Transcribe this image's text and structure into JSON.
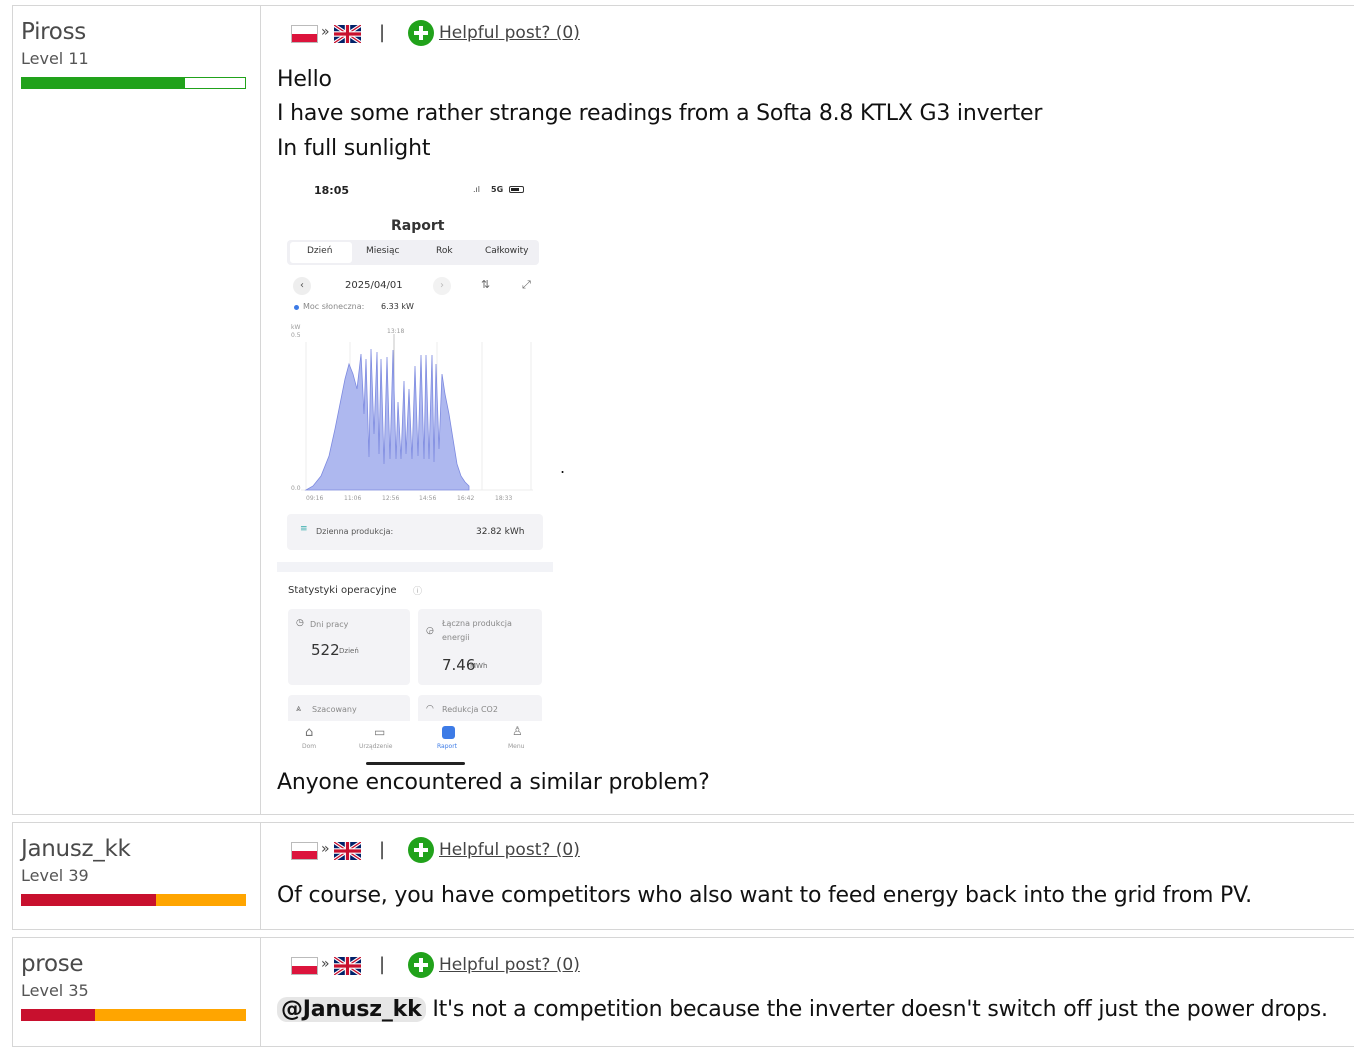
{
  "helpful_label": "Helpful post? (0)",
  "posts": [
    {
      "username": "Piross",
      "level": "Level 11",
      "level_progress": 0.73,
      "lines": [
        "Hello",
        "I have some rather strange readings from a Softa 8.8 KTLX G3 inverter",
        "In full sunlight"
      ],
      "after_image": "Anyone encountered a similar problem?",
      "trailing_mark": "."
    },
    {
      "username": "Janusz_kk",
      "level": "Level 39",
      "level_progress": 0.6,
      "text": "Of course, you have competitors who also want to feed energy back into the grid from PV."
    },
    {
      "username": "prose",
      "level": "Level 35",
      "level_progress": 0.33,
      "mention": "@Janusz_kk",
      "text": " It's not a competition because the inverter doesn't switch off just the power drops."
    }
  ],
  "screenshot": {
    "time": "18:05",
    "signal": "5G",
    "title": "Raport",
    "tabs": [
      "Dzień",
      "Miesiąc",
      "Rok",
      "Całkowity"
    ],
    "date": "2025/04/01",
    "legend_label": "Moc słoneczna:",
    "legend_value": "6.33 kW",
    "unit_label": "kW",
    "y_top": "0.5",
    "y_bottom": "0.0",
    "cursor_time": "13:18",
    "x_ticks": [
      "09:16",
      "11:06",
      "12:56",
      "14:56",
      "16:42",
      "18:33"
    ],
    "daily_label": "Dzienna produkcja:",
    "daily_value": "32.82 kWh",
    "stats_title": "Statystyki operacyjne",
    "days_label": "Dni pracy",
    "days_value": "522",
    "days_unit": "Dzień",
    "total_label_1": "Łączna produkcja",
    "total_label_2": "energii",
    "total_value": "7.46",
    "total_unit": "MWh",
    "est_label": "Szacowany",
    "co2_label": "Redukcja CO2",
    "nav": [
      "Dom",
      "Urządzenie",
      "Raport",
      "Menu"
    ],
    "colors": {
      "chart_fill": "#aeb8ef",
      "chart_line": "#7d8ae0",
      "accent": "#3d7be6"
    }
  },
  "colors": {
    "green": "#21a21b",
    "red": "#c8102e",
    "orange": "#ffa500"
  }
}
